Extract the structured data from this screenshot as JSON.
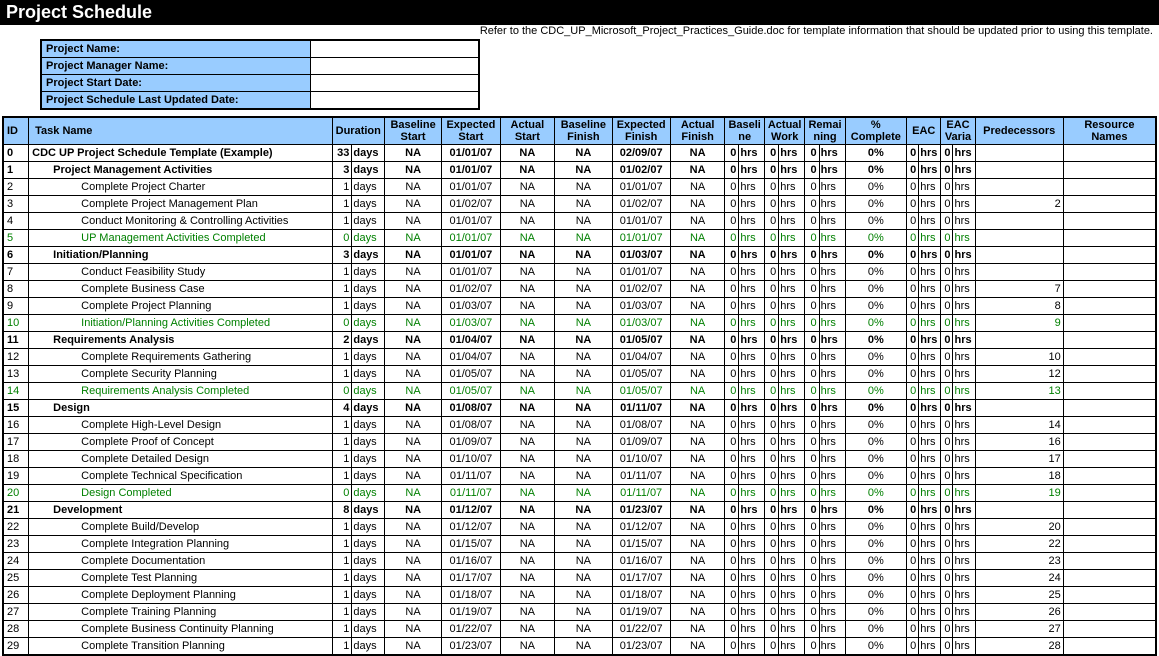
{
  "title": "Project Schedule",
  "note": "Refer to the CDC_UP_Microsoft_Project_Practices_Guide.doc for template information that should be updated prior to using this template.",
  "meta": [
    {
      "label": "Project Name:",
      "value": ""
    },
    {
      "label": "Project Manager Name:",
      "value": ""
    },
    {
      "label": "Project Start Date:",
      "value": ""
    },
    {
      "label": "Project Schedule Last Updated Date:",
      "value": ""
    }
  ],
  "headers": {
    "id": "ID",
    "task": "Task Name",
    "duration": "Duration",
    "bstart": "Baseline Start",
    "estart": "Expected Start",
    "astart": "Actual Start",
    "bfinish": "Baseline Finish",
    "efinish": "Expected Finish",
    "afinish": "Actual Finish",
    "baseline": "Baseli ne",
    "actualwork": "Actual Work",
    "remaining": "Remai ning",
    "pct": "% Complete",
    "eac": "EAC",
    "eacvar": "EAC Varia",
    "pred": "Predecessors",
    "res": "Resource Names"
  },
  "rows": [
    {
      "id": "0",
      "task": "CDC UP Project Schedule Template (Example)",
      "dur": "33",
      "estart": "01/01/07",
      "efinish": "02/09/07",
      "bold": true,
      "indent": 0
    },
    {
      "id": "1",
      "task": "Project Management Activities",
      "dur": "3",
      "estart": "01/01/07",
      "efinish": "01/02/07",
      "bold": true,
      "indent": 1
    },
    {
      "id": "2",
      "task": "Complete Project Charter",
      "dur": "1",
      "estart": "01/01/07",
      "efinish": "01/01/07",
      "indent": 2
    },
    {
      "id": "3",
      "task": "Complete Project Management Plan",
      "dur": "1",
      "estart": "01/02/07",
      "efinish": "01/02/07",
      "indent": 2,
      "pred": "2"
    },
    {
      "id": "4",
      "task": "Conduct Monitoring & Controlling Activities",
      "dur": "1",
      "estart": "01/01/07",
      "efinish": "01/01/07",
      "indent": 2
    },
    {
      "id": "5",
      "task": "UP Management Activities Completed",
      "dur": "0",
      "estart": "01/01/07",
      "efinish": "01/01/07",
      "indent": 2,
      "ms": true
    },
    {
      "id": "6",
      "task": "Initiation/Planning",
      "dur": "3",
      "estart": "01/01/07",
      "efinish": "01/03/07",
      "bold": true,
      "indent": 1
    },
    {
      "id": "7",
      "task": "Conduct Feasibility Study",
      "dur": "1",
      "estart": "01/01/07",
      "efinish": "01/01/07",
      "indent": 2
    },
    {
      "id": "8",
      "task": "Complete Business Case",
      "dur": "1",
      "estart": "01/02/07",
      "efinish": "01/02/07",
      "indent": 2,
      "pred": "7"
    },
    {
      "id": "9",
      "task": "Complete Project Planning",
      "dur": "1",
      "estart": "01/03/07",
      "efinish": "01/03/07",
      "indent": 2,
      "pred": "8"
    },
    {
      "id": "10",
      "task": "Initiation/Planning Activities Completed",
      "dur": "0",
      "estart": "01/03/07",
      "efinish": "01/03/07",
      "indent": 2,
      "ms": true,
      "pred": "9"
    },
    {
      "id": "11",
      "task": "Requirements Analysis",
      "dur": "2",
      "estart": "01/04/07",
      "efinish": "01/05/07",
      "bold": true,
      "indent": 1
    },
    {
      "id": "12",
      "task": "Complete Requirements Gathering",
      "dur": "1",
      "estart": "01/04/07",
      "efinish": "01/04/07",
      "indent": 2,
      "pred": "10"
    },
    {
      "id": "13",
      "task": "Complete Security Planning",
      "dur": "1",
      "estart": "01/05/07",
      "efinish": "01/05/07",
      "indent": 2,
      "pred": "12"
    },
    {
      "id": "14",
      "task": "Requirements Analysis Completed",
      "dur": "0",
      "estart": "01/05/07",
      "efinish": "01/05/07",
      "indent": 2,
      "ms": true,
      "pred": "13"
    },
    {
      "id": "15",
      "task": "Design",
      "dur": "4",
      "estart": "01/08/07",
      "efinish": "01/11/07",
      "bold": true,
      "indent": 1
    },
    {
      "id": "16",
      "task": "Complete High-Level Design",
      "dur": "1",
      "estart": "01/08/07",
      "efinish": "01/08/07",
      "indent": 2,
      "pred": "14"
    },
    {
      "id": "17",
      "task": "Complete Proof of Concept",
      "dur": "1",
      "estart": "01/09/07",
      "efinish": "01/09/07",
      "indent": 2,
      "pred": "16"
    },
    {
      "id": "18",
      "task": "Complete Detailed Design",
      "dur": "1",
      "estart": "01/10/07",
      "efinish": "01/10/07",
      "indent": 2,
      "pred": "17"
    },
    {
      "id": "19",
      "task": "Complete Technical Specification",
      "dur": "1",
      "estart": "01/11/07",
      "efinish": "01/11/07",
      "indent": 2,
      "pred": "18"
    },
    {
      "id": "20",
      "task": "Design Completed",
      "dur": "0",
      "estart": "01/11/07",
      "efinish": "01/11/07",
      "indent": 2,
      "ms": true,
      "pred": "19"
    },
    {
      "id": "21",
      "task": "Development",
      "dur": "8",
      "estart": "01/12/07",
      "efinish": "01/23/07",
      "bold": true,
      "indent": 1
    },
    {
      "id": "22",
      "task": "Complete Build/Develop",
      "dur": "1",
      "estart": "01/12/07",
      "efinish": "01/12/07",
      "indent": 2,
      "pred": "20"
    },
    {
      "id": "23",
      "task": "Complete Integration Planning",
      "dur": "1",
      "estart": "01/15/07",
      "efinish": "01/15/07",
      "indent": 2,
      "pred": "22"
    },
    {
      "id": "24",
      "task": "Complete Documentation",
      "dur": "1",
      "estart": "01/16/07",
      "efinish": "01/16/07",
      "indent": 2,
      "pred": "23"
    },
    {
      "id": "25",
      "task": "Complete Test Planning",
      "dur": "1",
      "estart": "01/17/07",
      "efinish": "01/17/07",
      "indent": 2,
      "pred": "24"
    },
    {
      "id": "26",
      "task": "Complete Deployment Planning",
      "dur": "1",
      "estart": "01/18/07",
      "efinish": "01/18/07",
      "indent": 2,
      "pred": "25"
    },
    {
      "id": "27",
      "task": "Complete Training Planning",
      "dur": "1",
      "estart": "01/19/07",
      "efinish": "01/19/07",
      "indent": 2,
      "pred": "26"
    },
    {
      "id": "28",
      "task": "Complete Business Continuity Planning",
      "dur": "1",
      "estart": "01/22/07",
      "efinish": "01/22/07",
      "indent": 2,
      "pred": "27"
    },
    {
      "id": "29",
      "task": "Complete Transition Planning",
      "dur": "1",
      "estart": "01/23/07",
      "efinish": "01/23/07",
      "indent": 2,
      "pred": "28"
    }
  ],
  "defaults": {
    "na": "NA",
    "days": "days",
    "hrs": "hrs",
    "zero": "0",
    "pct": "0%"
  }
}
